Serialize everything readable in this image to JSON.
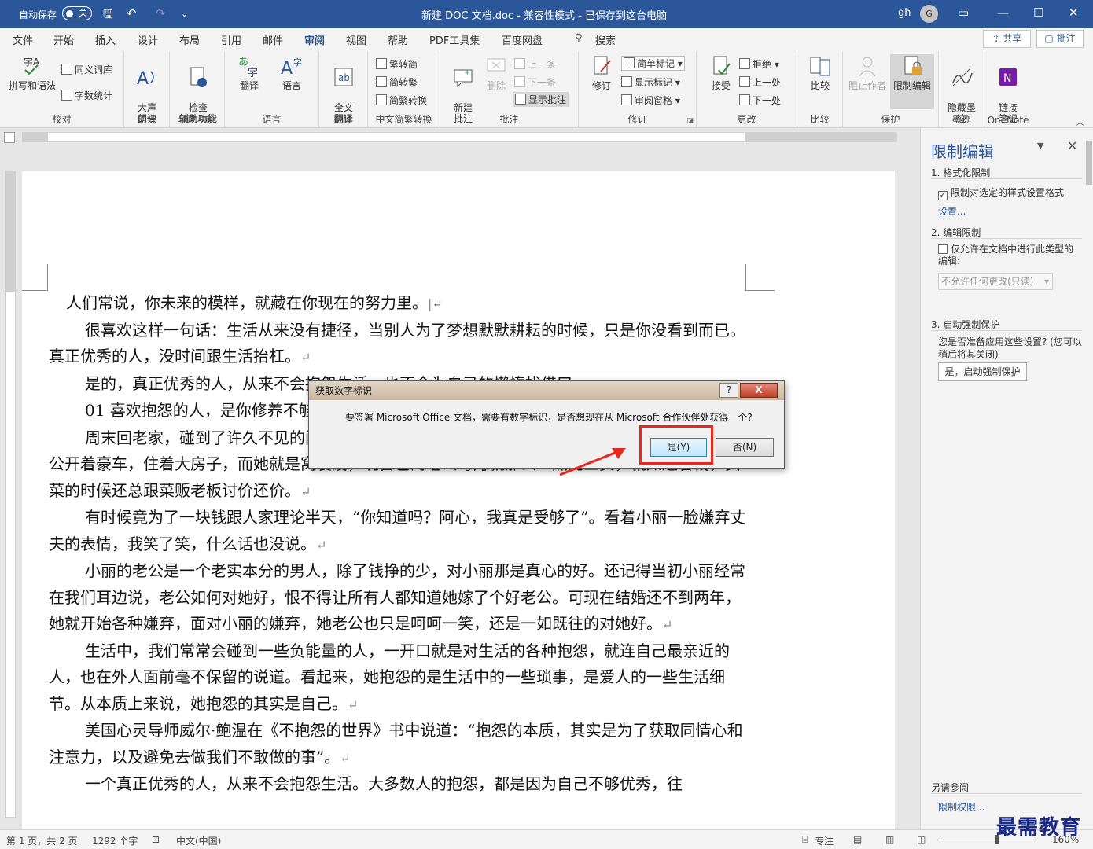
{
  "titlebar": {
    "autosave_label": "自动保存",
    "autosave_state": "关",
    "doc_title": "新建 DOC 文档.doc  -  兼容性模式  -  已保存到这台电脑",
    "user_name": "gh",
    "user_initial": "G"
  },
  "tabs": [
    {
      "label": "文件"
    },
    {
      "label": "开始"
    },
    {
      "label": "插入"
    },
    {
      "label": "设计"
    },
    {
      "label": "布局"
    },
    {
      "label": "引用"
    },
    {
      "label": "邮件"
    },
    {
      "label": "审阅"
    },
    {
      "label": "视图"
    },
    {
      "label": "帮助"
    },
    {
      "label": "PDF工具集"
    },
    {
      "label": "百度网盘"
    },
    {
      "label": "搜索"
    }
  ],
  "share_label": "共享",
  "comment_label": "批注",
  "ribbon": {
    "proofing": {
      "label": "校对",
      "spell": "拼写和语法",
      "thesaurus": "同义词库",
      "wordcount": "字数统计"
    },
    "speech": {
      "label": "语音",
      "read": "大声\n朗读"
    },
    "accessibility": {
      "label": "辅助功能",
      "check": "检查\n辅助功能"
    },
    "language": {
      "label": "语言",
      "translate": "翻译",
      "language": "语言"
    },
    "translation": {
      "label": "翻译",
      "full": "全文\n翻译"
    },
    "chinese": {
      "label": "中文简繁转换",
      "t2s": "繁转简",
      "s2t": "简转繁",
      "convert": "简繁转换"
    },
    "comments": {
      "label": "批注",
      "new": "新建\n批注",
      "delete": "删除",
      "prev": "上一条",
      "next": "下一条",
      "show": "显示批注"
    },
    "tracking": {
      "label": "修订",
      "track": "修订",
      "simple": "简单标记",
      "markup": "显示标记",
      "pane": "审阅窗格"
    },
    "changes": {
      "label": "更改",
      "accept": "接受",
      "reject": "拒绝",
      "prev": "上一处",
      "next": "下一处"
    },
    "compare": {
      "label": "比较",
      "compare": "比较"
    },
    "protect": {
      "label": "保护",
      "block": "阻止作者",
      "restrict": "限制编辑"
    },
    "ink": {
      "label": "墨迹",
      "hide": "隐藏墨\n迹"
    },
    "onenote": {
      "label": "OneNote",
      "link": "链接\n笔记"
    }
  },
  "document": {
    "paragraphs": [
      {
        "text": "人们常说，你未来的模样，就藏在你现在的努力里。",
        "indent": "half"
      },
      {
        "text": "很喜欢这样一句话：生活从来没有捷径，当别人为了梦想默默耕耘的时候，只是你没看到而已。真正优秀的人，没时间跟生活抬杠。",
        "indent": "full"
      },
      {
        "text": "是的，真正优秀的人，从来不会抱怨生活，也不会为自己的懒惰找借口。",
        "indent": "full"
      },
      {
        "text": "01  喜欢抱怨的人，是你修养不够",
        "indent": "full"
      },
      {
        "text": "周末回老家，碰到了许久不见的闺蜜小丽，一见面她就开始跟我吐槽她老公的种种，说闺蜜的老公开着豪车，住着大房子，而她就是窝囊废，说自己的老公每月就那么一点死工资，就知道省钱，买菜的时候还总跟菜贩老板讨价还价。",
        "indent": "full"
      },
      {
        "text": "有时候竟为了一块钱跟人家理论半天，“你知道吗？阿心，我真是受够了”。看着小丽一脸嫌弃丈夫的表情，我笑了笑，什么话也没说。",
        "indent": "full"
      },
      {
        "text": "小丽的老公是一个老实本分的男人，除了钱挣的少，对小丽那是真心的好。还记得当初小丽经常在我们耳边说，老公如何对她好，恨不得让所有人都知道她嫁了个好老公。可现在结婚还不到两年，她就开始各种嫌弃，面对小丽的嫌弃，她老公也只是呵呵一笑，还是一如既往的对她好。",
        "indent": "full"
      },
      {
        "text": "生活中，我们常常会碰到一些负能量的人，一开口就是对生活的各种抱怨，就连自己最亲近的人，也在外人面前毫不保留的说道。看起来，她抱怨的是生活中的一些琐事，是爱人的一些生活细节。从本质上来说，她抱怨的其实是自己。",
        "indent": "full"
      },
      {
        "text": "美国心灵导师威尔·鲍温在《不抱怨的世界》书中说道：“抱怨的本质，其实是为了获取同情心和注意力，以及避免去做我们不敢做的事”。",
        "indent": "full"
      },
      {
        "text": "一个真正优秀的人，从来不会抱怨生活。大多数人的抱怨，都是因为自己不够优秀，往",
        "indent": "full"
      }
    ]
  },
  "dialog": {
    "title": "获取数字标识",
    "help": "?",
    "close": "X",
    "message": "要签署 Microsoft Office 文档，需要有数字标识，是否想现在从 Microsoft 合作伙伴处获得一个?",
    "yes": "是(Y)",
    "no": "否(N)"
  },
  "pane": {
    "title": "限制编辑",
    "sec1": "1. 格式化限制",
    "chk1": "限制对选定的样式设置格式",
    "settings": "设置...",
    "sec2": "2. 编辑限制",
    "chk2": "仅允许在文档中进行此类型的编辑:",
    "select": "不允许任何更改(只读)",
    "sec3": "3. 启动强制保护",
    "desc": "您是否准备应用这些设置? (您可以稍后将其关闭)",
    "button": "是，启动强制保护",
    "see_also": "另请参阅",
    "perm_link": "限制权限..."
  },
  "status": {
    "page": "第 1 页，共 2 页",
    "words": "1292 个字",
    "language": "中文(中国)",
    "focus": "专注",
    "zoom": "160%"
  },
  "watermark": "最需教育"
}
